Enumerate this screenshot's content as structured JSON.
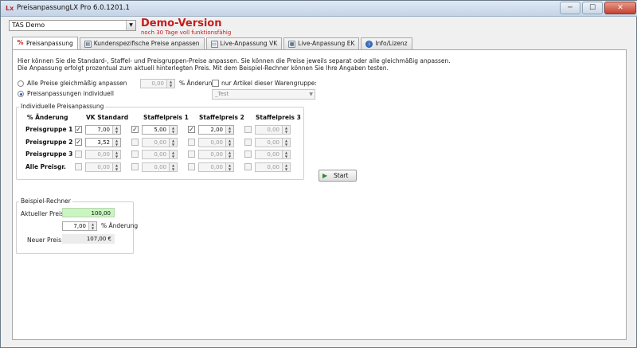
{
  "window": {
    "title": "PreisanpassungLX Pro 6.0.1201.1",
    "logo": "Lx",
    "buttons": [
      "─",
      "☐",
      "✕"
    ]
  },
  "customer_select": {
    "value": "TAS Demo"
  },
  "demo": {
    "title": "Demo-Version",
    "subtitle": "noch 30 Tage voll funktionsfähig"
  },
  "tabs": [
    {
      "label": "Preisanpassung",
      "icon": "percent-icon"
    },
    {
      "label": "Kundenspezifische Preise anpassen",
      "icon": "address-book-icon"
    },
    {
      "label": "Live-Anpassung VK",
      "icon": "monitor-icon"
    },
    {
      "label": "Live-Anpassung EK",
      "icon": "table-icon"
    },
    {
      "label": "Info/Lizenz",
      "icon": "info-icon"
    }
  ],
  "intro": {
    "line1": "Hier können Sie die Standard-, Staffel- und Preisgruppen-Preise anpassen. Sie können die Preise jeweils separat oder alle gleichmäßig anpassen.",
    "line2": "Die Anpassung erfolgt prozentual zum aktuell hinterlegten Preis. Mit dem Beispiel-Rechner können Sie Ihre Angaben testen."
  },
  "mode": {
    "all_label": "Alle Preise gleichmäßig anpassen",
    "individual_label": "Preisanpassungen individuell",
    "selected": "individual",
    "all_value": "0,00",
    "pct_label": "% Änderung"
  },
  "warengruppe": {
    "checkbox_label": "nur Artikel dieser Warengruppe:",
    "checked": false,
    "value": "_Test"
  },
  "grid": {
    "group_title": "Individuelle Preisanpassung",
    "corner": "% Änderung",
    "columns": [
      "VK Standard",
      "Staffelpreis 1",
      "Staffelpreis 2",
      "Staffelpreis 3"
    ],
    "rows": [
      {
        "label": "Preisgruppe 1",
        "cells": [
          {
            "checked": true,
            "value": "7,00"
          },
          {
            "checked": true,
            "value": "5,00"
          },
          {
            "checked": true,
            "value": "2,00"
          },
          {
            "checked": false,
            "value": "0,00"
          }
        ]
      },
      {
        "label": "Preisgruppe 2",
        "cells": [
          {
            "checked": true,
            "value": "3,52"
          },
          {
            "checked": false,
            "value": "0,00"
          },
          {
            "checked": false,
            "value": "0,00"
          },
          {
            "checked": false,
            "value": "0,00"
          }
        ]
      },
      {
        "label": "Preisgruppe 3",
        "cells": [
          {
            "checked": false,
            "value": "0,00"
          },
          {
            "checked": false,
            "value": "0,00"
          },
          {
            "checked": false,
            "value": "0,00"
          },
          {
            "checked": false,
            "value": "0,00"
          }
        ]
      },
      {
        "label": "Alle Preisgr.",
        "cells": [
          {
            "checked": false,
            "value": "0,00"
          },
          {
            "checked": false,
            "value": "0,00"
          },
          {
            "checked": false,
            "value": "0,00"
          },
          {
            "checked": false,
            "value": "0,00"
          }
        ]
      }
    ]
  },
  "start_button": {
    "label": "Start"
  },
  "calculator": {
    "title": "Beispiel-Rechner",
    "current_label": "Aktueller Preis:",
    "current_value": "100,00",
    "change_value": "7,00",
    "change_label": "% Änderung",
    "new_label": "Neuer Preis:",
    "new_value": "107,00 €"
  },
  "colors": {
    "accent_red": "#c41e1e",
    "current_price_bg": "#c8f5c0"
  }
}
